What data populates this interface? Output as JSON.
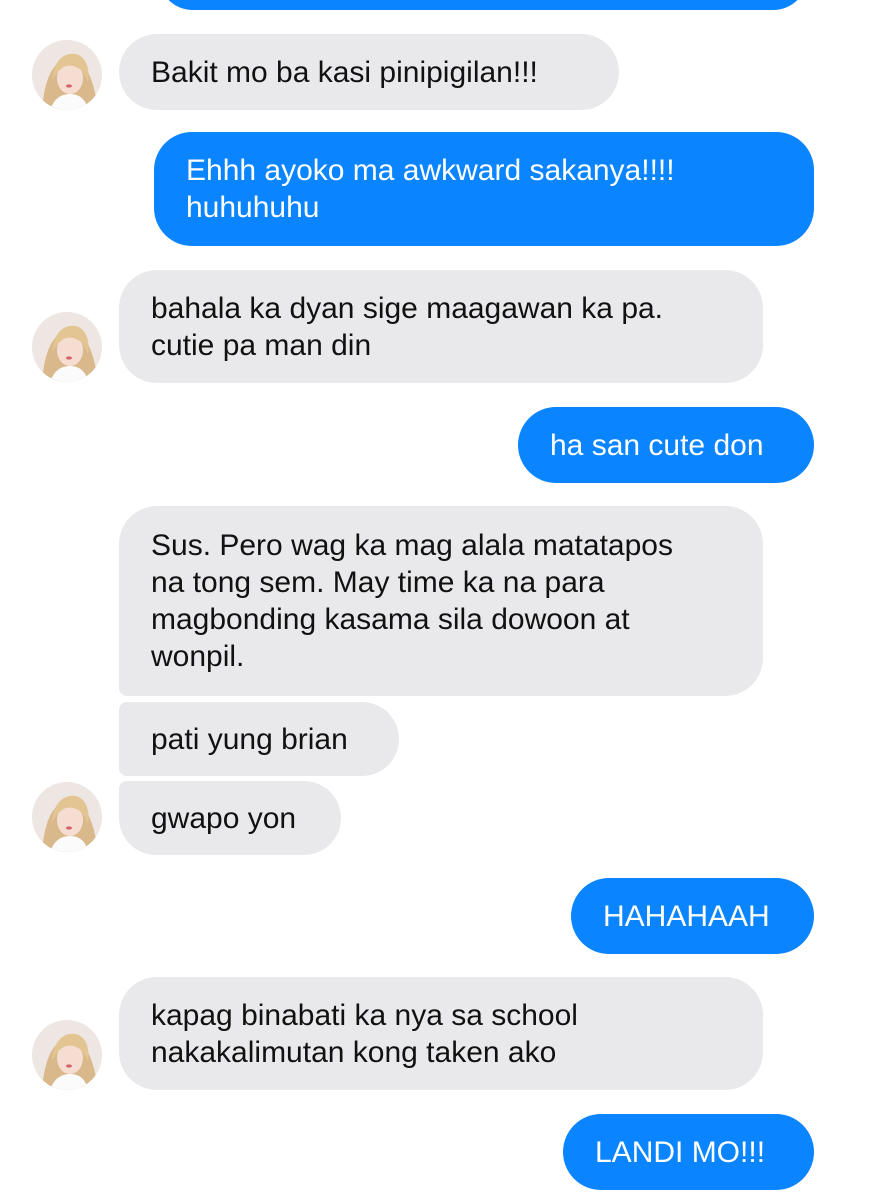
{
  "conversation": {
    "messages": [
      {
        "sender": "self",
        "text": ""
      },
      {
        "sender": "contact",
        "text": "Bakit mo ba kasi pinipigilan!!!"
      },
      {
        "sender": "self",
        "text": "Ehhh ayoko ma awkward sakanya!!!!\nhuhuhuhu"
      },
      {
        "sender": "contact",
        "text": "bahala ka dyan sige maagawan ka pa.\ncutie pa man din"
      },
      {
        "sender": "self",
        "text": "ha san cute don"
      },
      {
        "sender": "contact",
        "text": "Sus. Pero wag ka mag alala matatapos\nna tong sem. May time ka na para\nmagbonding kasama sila dowoon at\nwonpil."
      },
      {
        "sender": "contact",
        "text": "pati yung brian"
      },
      {
        "sender": "contact",
        "text": "gwapo yon"
      },
      {
        "sender": "self",
        "text": "HAHAHAAH"
      },
      {
        "sender": "contact",
        "text": "kapag binabati ka nya sa school\nnakakalimutan kong taken ako"
      },
      {
        "sender": "self",
        "text": "LANDI MO!!!"
      }
    ]
  },
  "colors": {
    "outgoing_bubble": "#0a84ff",
    "incoming_bubble": "#e9e9eb",
    "background": "#ffffff"
  },
  "icons": {
    "contact_avatar": "contact-avatar-photo"
  }
}
